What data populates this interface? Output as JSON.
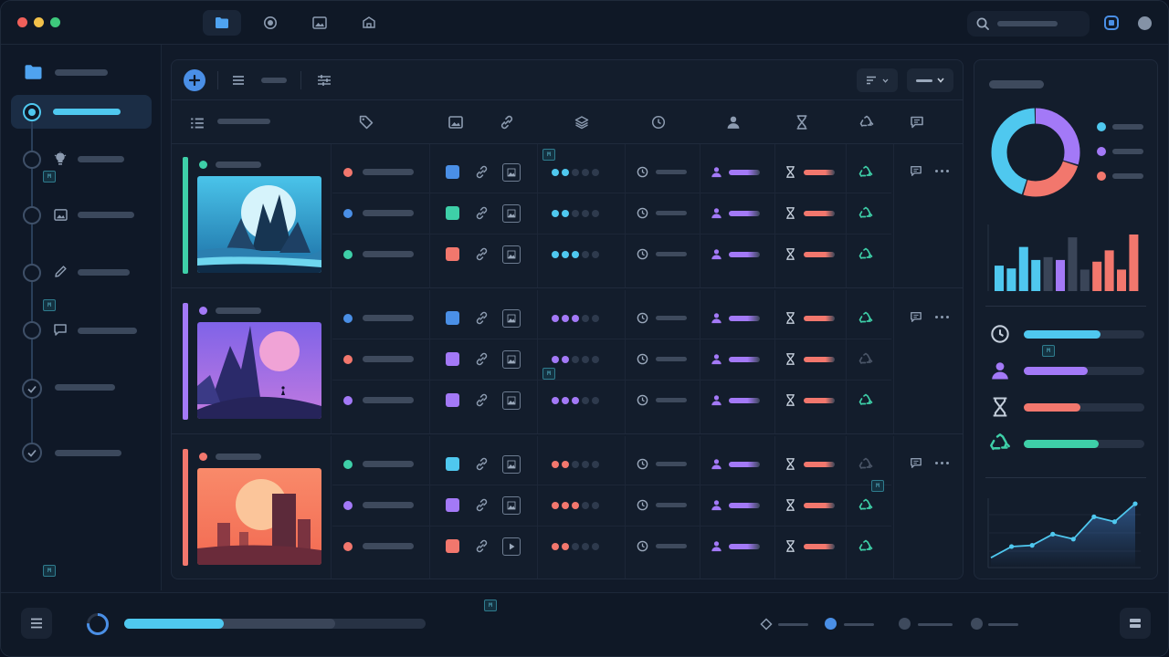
{
  "colors": {
    "accent_cyan": "#4fc8ef",
    "purple": "#a379f7",
    "coral": "#f2776d",
    "teal": "#3ecfa8",
    "blue": "#4a8fe6"
  },
  "titlebar": {
    "tabs": [
      "folder-icon",
      "record-icon",
      "image-icon",
      "package-icon"
    ],
    "active_tab": 0,
    "search": {
      "icon": "search-icon"
    }
  },
  "sidebar": {
    "items": [
      {
        "icon": "folder-icon"
      },
      {
        "icon": "target-icon",
        "active": true
      },
      {
        "icon": "bulb-icon"
      },
      {
        "icon": "image-icon"
      },
      {
        "icon": "pencil-icon"
      },
      {
        "icon": "chat-icon"
      },
      {
        "icon": "check-icon"
      },
      {
        "icon": "check-icon"
      }
    ]
  },
  "groups": [
    {
      "accent": "#3ecfa8",
      "dot": "#3ecfa8",
      "scene": "mountains-cyan",
      "rows": [
        {
          "dot": "#f2776d",
          "square": "#4a8fe6",
          "rating_color": "#4fc8ef",
          "rating": 2,
          "recycle_active": true
        },
        {
          "dot": "#4a8fe6",
          "square": "#3ecfa8",
          "rating_color": "#4fc8ef",
          "rating": 2,
          "recycle_active": true
        },
        {
          "dot": "#3ecfa8",
          "square": "#f2776d",
          "rating_color": "#4fc8ef",
          "rating": 3,
          "recycle_active": true
        }
      ]
    },
    {
      "accent": "#a379f7",
      "dot": "#a379f7",
      "scene": "mountains-purple",
      "rows": [
        {
          "dot": "#4a8fe6",
          "square": "#4a8fe6",
          "rating_color": "#a379f7",
          "rating": 3,
          "recycle_active": true
        },
        {
          "dot": "#f2776d",
          "square": "#a379f7",
          "rating_color": "#a379f7",
          "rating": 2,
          "recycle_active": false
        },
        {
          "dot": "#a379f7",
          "square": "#a379f7",
          "rating_color": "#a379f7",
          "rating": 3,
          "recycle_active": true
        }
      ]
    },
    {
      "accent": "#f2776d",
      "dot": "#f2776d",
      "scene": "desert-coral",
      "rows": [
        {
          "dot": "#3ecfa8",
          "square": "#4fc8ef",
          "rating_color": "#f2776d",
          "rating": 2,
          "recycle_active": false
        },
        {
          "dot": "#a379f7",
          "square": "#a379f7",
          "rating_color": "#f2776d",
          "rating": 3,
          "recycle_active": true
        },
        {
          "dot": "#f2776d",
          "square": "#f2776d",
          "rating_color": "#f2776d",
          "rating": 2,
          "recycle_active": true
        }
      ]
    }
  ],
  "right_panel": {
    "donut": [
      {
        "color": "#a379f7",
        "fraction": 0.3
      },
      {
        "color": "#f2776d",
        "fraction": 0.25
      },
      {
        "color": "#4fc8ef",
        "fraction": 0.45
      }
    ],
    "legend": [
      "#4fc8ef",
      "#a379f7",
      "#f2776d"
    ],
    "bars": [
      {
        "v": 0.45,
        "c": "#4fc8ef"
      },
      {
        "v": 0.4,
        "c": "#4fc8ef"
      },
      {
        "v": 0.78,
        "c": "#4fc8ef"
      },
      {
        "v": 0.55,
        "c": "#4fc8ef"
      },
      {
        "v": 0.6,
        "c": "#3a4558"
      },
      {
        "v": 0.55,
        "c": "#a379f7"
      },
      {
        "v": 0.95,
        "c": "#3a4558"
      },
      {
        "v": 0.38,
        "c": "#3a4558"
      },
      {
        "v": 0.52,
        "c": "#f2776d"
      },
      {
        "v": 0.72,
        "c": "#f2776d"
      },
      {
        "v": 0.38,
        "c": "#f2776d"
      },
      {
        "v": 1.0,
        "c": "#f2776d"
      }
    ],
    "stats": [
      {
        "icon": "clock-icon",
        "color": "#4fc8ef",
        "value": 0.64
      },
      {
        "icon": "user-icon",
        "color": "#a379f7",
        "value": 0.53
      },
      {
        "icon": "hourglass-icon",
        "color": "#f2776d",
        "value": 0.47
      },
      {
        "icon": "recycle-icon",
        "color": "#3ecfa8",
        "value": 0.62
      }
    ],
    "line": [
      0.1,
      0.28,
      0.3,
      0.48,
      0.4,
      0.76,
      0.68,
      0.97
    ]
  },
  "bottom": {
    "progress": 0.33,
    "buffer": 0.7
  }
}
